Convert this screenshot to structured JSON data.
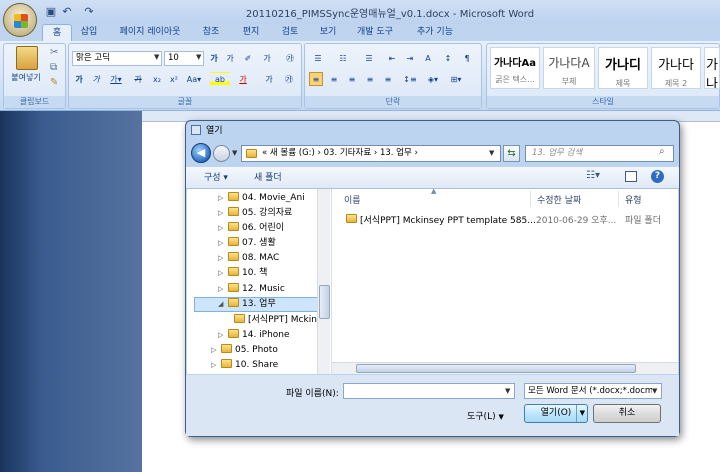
{
  "window": {
    "title": "20110216_PIMSSync운영매뉴얼_v0.1.docx - Microsoft Word"
  },
  "ribbon_tabs": [
    "홈",
    "삽입",
    "페이지 레이아웃",
    "참조",
    "편지",
    "검토",
    "보기",
    "개발 도구",
    "추가 기능"
  ],
  "clipboard": {
    "paste_label": "붙여넣기",
    "group_label": "클립보드"
  },
  "font": {
    "name": "맑은 고딕",
    "size": "10",
    "group_label": "글꼴"
  },
  "paragraph": {
    "group_label": "단락"
  },
  "styles": {
    "group_label": "스타일",
    "items": [
      {
        "preview": "가나다Aa",
        "name": "굵은 텍스..."
      },
      {
        "preview": "가나다A",
        "name": "부제"
      },
      {
        "preview": "가나디",
        "name": "제목"
      },
      {
        "preview": "가나다",
        "name": "제목 2"
      },
      {
        "preview": "가나",
        "name": "ㅈ"
      }
    ]
  },
  "dialog": {
    "title": "열기",
    "breadcrumb": "« 새 볼륨 (G:) › 03. 기타자료 › 13. 업무 ›",
    "search_placeholder": "13. 업무 검색",
    "organize_label": "구성 ▾",
    "new_folder_label": "새 폴더",
    "nav_items": [
      {
        "label": "04. Movie_Ani",
        "indent": 2
      },
      {
        "label": "05. 강의자료",
        "indent": 2
      },
      {
        "label": "06. 어린이",
        "indent": 2
      },
      {
        "label": "07. 생활",
        "indent": 2
      },
      {
        "label": "08. MAC",
        "indent": 2
      },
      {
        "label": "10. 책",
        "indent": 2
      },
      {
        "label": "12. Music",
        "indent": 2
      },
      {
        "label": "13. 업무",
        "indent": 2
      },
      {
        "label": "[서식PPT] Mckinsey",
        "indent": 3
      },
      {
        "label": "14. iPhone",
        "indent": 2
      },
      {
        "label": "05. Photo",
        "indent": 1
      },
      {
        "label": "10. Share",
        "indent": 1
      }
    ],
    "columns": [
      "이름",
      "수정한 날짜",
      "유형"
    ],
    "files": [
      {
        "name": "[서식PPT] Mckinsey PPT template 585...",
        "date": "2010-06-29 오후...",
        "type": "파일 폴더"
      }
    ],
    "filename_label": "파일 이름(N):",
    "filename_value": "",
    "filetype_value": "모든 Word 문서 (*.docx;*.docm",
    "tools_label": "도구(L)",
    "open_label": "열기(O)",
    "cancel_label": "취소"
  }
}
